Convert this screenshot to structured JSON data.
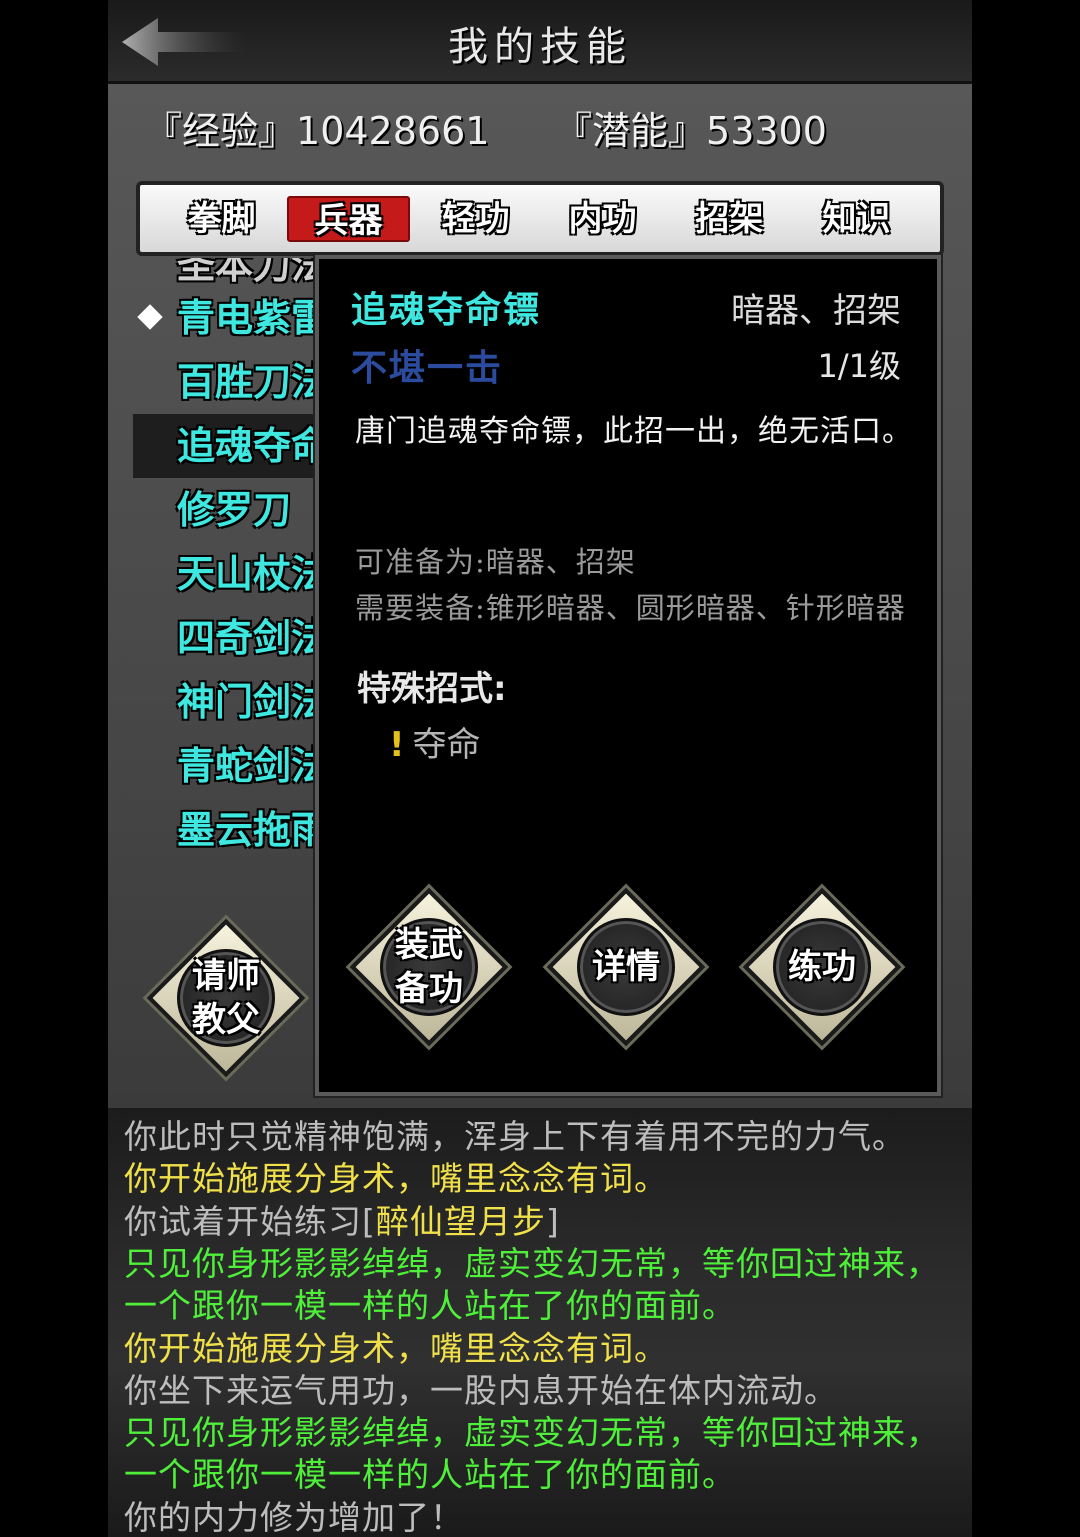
{
  "header": {
    "title": "我的技能"
  },
  "stats": {
    "exp_label": "『经验』",
    "exp_value": "10428661",
    "pot_label": "『潜能』",
    "pot_value": "53300"
  },
  "tabs": [
    {
      "label": "拳脚"
    },
    {
      "label": "兵器"
    },
    {
      "label": "轻功"
    },
    {
      "label": "内功"
    },
    {
      "label": "招架"
    },
    {
      "label": "知识"
    }
  ],
  "active_tab": "兵器",
  "skills": {
    "partial_top": "圣本刀法",
    "items": [
      {
        "label": "青电紫雷"
      },
      {
        "label": "百胜刀法"
      },
      {
        "label": "追魂夺命"
      },
      {
        "label": "修罗刀"
      },
      {
        "label": "天山杖法"
      },
      {
        "label": "四奇剑法"
      },
      {
        "label": "神门剑法"
      },
      {
        "label": "青蛇剑法"
      },
      {
        "label": "墨云拖雨"
      }
    ]
  },
  "popup": {
    "name": "追魂夺命镖",
    "type": "暗器、招架",
    "rank": "不堪一击",
    "level": "1/1级",
    "description": "唐门追魂夺命镖，此招一出，绝无活口。",
    "prepare": "可准备为:暗器、招架",
    "equip": "需要装备:锥形暗器、圆形暗器、针形暗器",
    "special_title": "特殊招式:",
    "special_mark": "!",
    "special_item": "夺命",
    "buttons": {
      "equip": "装武备功",
      "detail": "详情",
      "train": "练功"
    }
  },
  "master_button": "请师教父",
  "colors": {
    "cyan": "#3ee8e0",
    "active_tab": "#c41a1a",
    "log_yellow": "#f0e04a",
    "log_green": "#4ff03a"
  },
  "log": [
    {
      "text": "你此时只觉精神饱满，浑身上下有着用不完的力气。",
      "color": "white"
    },
    {
      "text": "你开始施展分身术，嘴里念念有词。",
      "color": "yellow"
    },
    {
      "text": "你试着开始练习[醉仙望月步]",
      "color": "white",
      "highlight": "醉仙望月步"
    },
    {
      "text": "只见你身形影影绰绰，虚实变幻无常，等你回过神来，",
      "color": "green"
    },
    {
      "text": "一个跟你一模一样的人站在了你的面前。",
      "color": "green"
    },
    {
      "text": "你开始施展分身术，嘴里念念有词。",
      "color": "yellow"
    },
    {
      "text": "你坐下来运气用功，一股内息开始在体内流动。",
      "color": "white"
    },
    {
      "text": "只见你身形影影绰绰，虚实变幻无常，等你回过神来，",
      "color": "green"
    },
    {
      "text": "一个跟你一模一样的人站在了你的面前。",
      "color": "green"
    },
    {
      "text": "你的内力修为增加了！",
      "color": "white"
    }
  ]
}
